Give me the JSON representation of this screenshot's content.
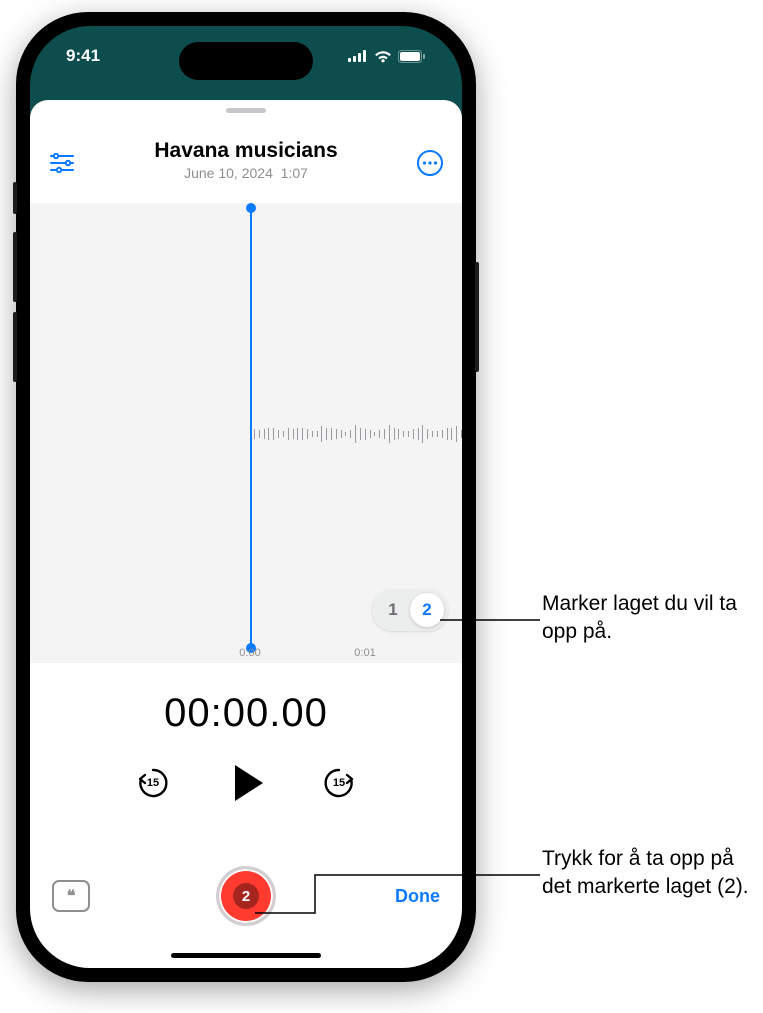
{
  "status": {
    "time": "9:41"
  },
  "header": {
    "title": "Havana musicians",
    "subtitle_date": "June 10, 2024",
    "subtitle_duration": "1:07"
  },
  "ruler": {
    "t0": "0:00",
    "t1": "0:01"
  },
  "layers": {
    "opt1": "1",
    "opt2": "2",
    "selected": 2
  },
  "timer": "00:00.00",
  "skip_seconds": "15",
  "record_layer": "2",
  "done_label": "Done",
  "transcript_glyph": "❝",
  "callouts": {
    "layers": "Marker laget du vil ta opp på.",
    "record": "Trykk for å ta opp på det markerte laget (2)."
  }
}
